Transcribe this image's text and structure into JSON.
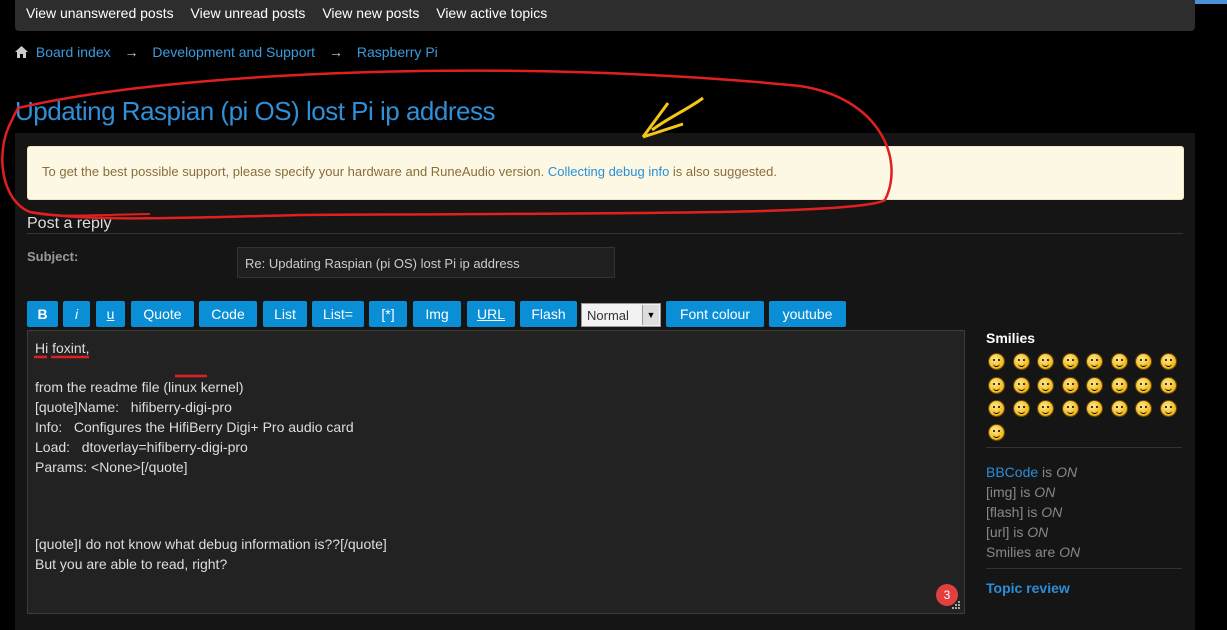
{
  "nav": {
    "links": [
      "View unanswered posts",
      "View unread posts",
      "View new posts",
      "View active topics"
    ]
  },
  "breadcrumb": {
    "items": [
      "Board index",
      "Development and Support",
      "Raspberry Pi"
    ],
    "separator": "→"
  },
  "topic": {
    "title": "Updating Raspian (pi OS) lost Pi ip address"
  },
  "notice": {
    "before": "To get the best possible support, please specify your hardware and RuneAudio version.",
    "link": "Collecting debug info",
    "after": "is also suggested."
  },
  "post_form": {
    "heading": "Post a reply",
    "subject_label": "Subject:",
    "subject_value": "Re: Updating Raspian (pi OS) lost Pi ip address"
  },
  "toolbar": {
    "buttons": [
      "B",
      "i",
      "u",
      "Quote",
      "Code",
      "List",
      "List=",
      "[*]",
      "Img",
      "URL",
      "Flash"
    ],
    "font_size_select": "Normal",
    "buttons_after": [
      "Font colour",
      "youtube"
    ]
  },
  "editor": {
    "lines": [
      "Hi foxint,",
      "",
      "from the readme file (linux kernel)",
      "[quote]Name:   hifiberry-digi-pro",
      "Info:   Configures the HifiBerry Digi+ Pro audio card",
      "Load:   dtoverlay=hifiberry-digi-pro",
      "Params: <None>[/quote]",
      "",
      "",
      "",
      "[quote]I do not know what debug information is??[/quote]",
      "But you are able to read, right?"
    ],
    "badge_count": "3"
  },
  "sidebar": {
    "smilies_title": "Smilies",
    "smiley_count": 25,
    "options": [
      {
        "label": "BBCode",
        "state": "ON",
        "verb": "is"
      },
      {
        "label": "[img]",
        "state": "ON",
        "verb": "is"
      },
      {
        "label": "[flash]",
        "state": "ON",
        "verb": "is"
      },
      {
        "label": "[url]",
        "state": "ON",
        "verb": "is"
      },
      {
        "label": "Smilies",
        "state": "ON",
        "verb": "are"
      }
    ],
    "topic_review": "Topic review"
  },
  "colors": {
    "accent": "#2f8fd8",
    "button": "#0a8fd6",
    "notice_bg": "#fcf8e3",
    "annotation_red": "#e02020",
    "annotation_yellow": "#f5c518"
  }
}
